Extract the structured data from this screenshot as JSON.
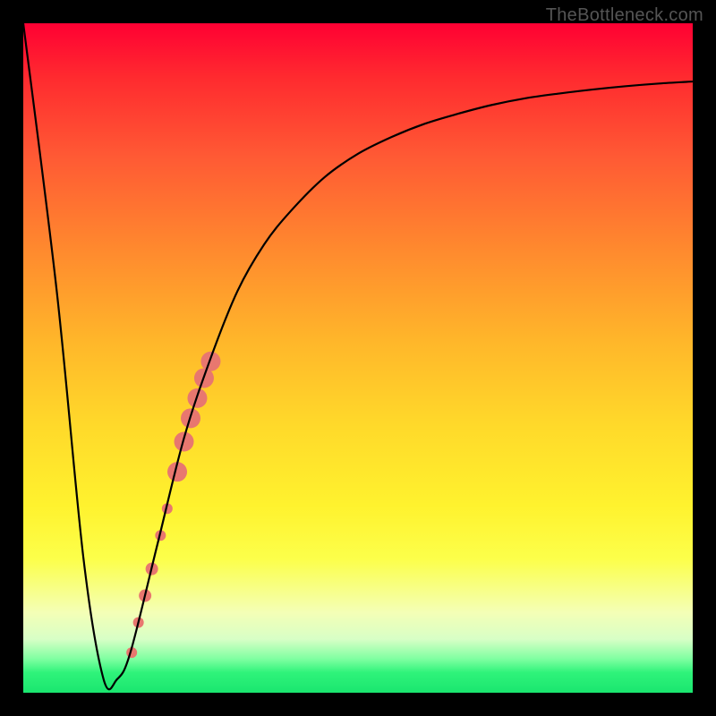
{
  "watermark": "TheBottleneck.com",
  "chart_data": {
    "type": "line",
    "title": "",
    "xlabel": "",
    "ylabel": "",
    "xlim": [
      0,
      100
    ],
    "ylim": [
      0,
      100
    ],
    "grid": false,
    "series": [
      {
        "name": "bottleneck-curve",
        "x": [
          0,
          5,
          9,
          12,
          14,
          16,
          20,
          24,
          28,
          32,
          36,
          40,
          45,
          50,
          55,
          60,
          65,
          70,
          75,
          80,
          85,
          90,
          95,
          100
        ],
        "y": [
          100,
          60,
          20,
          2,
          2,
          6,
          22,
          38,
          50,
          60,
          67,
          72,
          77,
          80.5,
          83,
          85,
          86.5,
          87.8,
          88.8,
          89.5,
          90.1,
          90.6,
          91,
          91.3
        ]
      }
    ],
    "highlight_points": {
      "name": "marked-segment",
      "color": "#e8776f",
      "points": [
        {
          "x": 16.2,
          "y": 6.0,
          "r": 6
        },
        {
          "x": 17.2,
          "y": 10.5,
          "r": 6
        },
        {
          "x": 18.2,
          "y": 14.5,
          "r": 7
        },
        {
          "x": 19.2,
          "y": 18.5,
          "r": 7
        },
        {
          "x": 20.5,
          "y": 23.5,
          "r": 6
        },
        {
          "x": 21.5,
          "y": 27.5,
          "r": 6
        },
        {
          "x": 23.0,
          "y": 33.0,
          "r": 11
        },
        {
          "x": 24.0,
          "y": 37.5,
          "r": 11
        },
        {
          "x": 25.0,
          "y": 41.0,
          "r": 11
        },
        {
          "x": 26.0,
          "y": 44.0,
          "r": 11
        },
        {
          "x": 27.0,
          "y": 47.0,
          "r": 11
        },
        {
          "x": 28.0,
          "y": 49.5,
          "r": 11
        }
      ]
    }
  }
}
